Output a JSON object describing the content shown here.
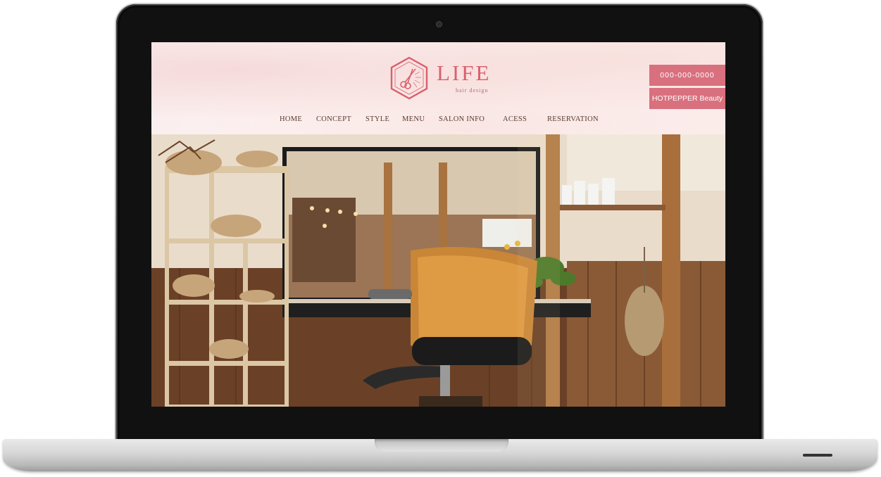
{
  "site": {
    "logo": {
      "word": "LIFE",
      "sub": "hair design"
    },
    "nav": [
      "HOME",
      "CONCEPT",
      "STYLE",
      "MENU",
      "SALON INFO",
      "ACESS",
      "RESERVATION"
    ],
    "cta": {
      "phone": "000-000-0000",
      "hotpepper": "HOTPEPPER Beauty"
    }
  },
  "colors": {
    "brand_pink": "#d9706e",
    "logo_pink": "#d9606e",
    "nav_text": "#5a3a32"
  }
}
